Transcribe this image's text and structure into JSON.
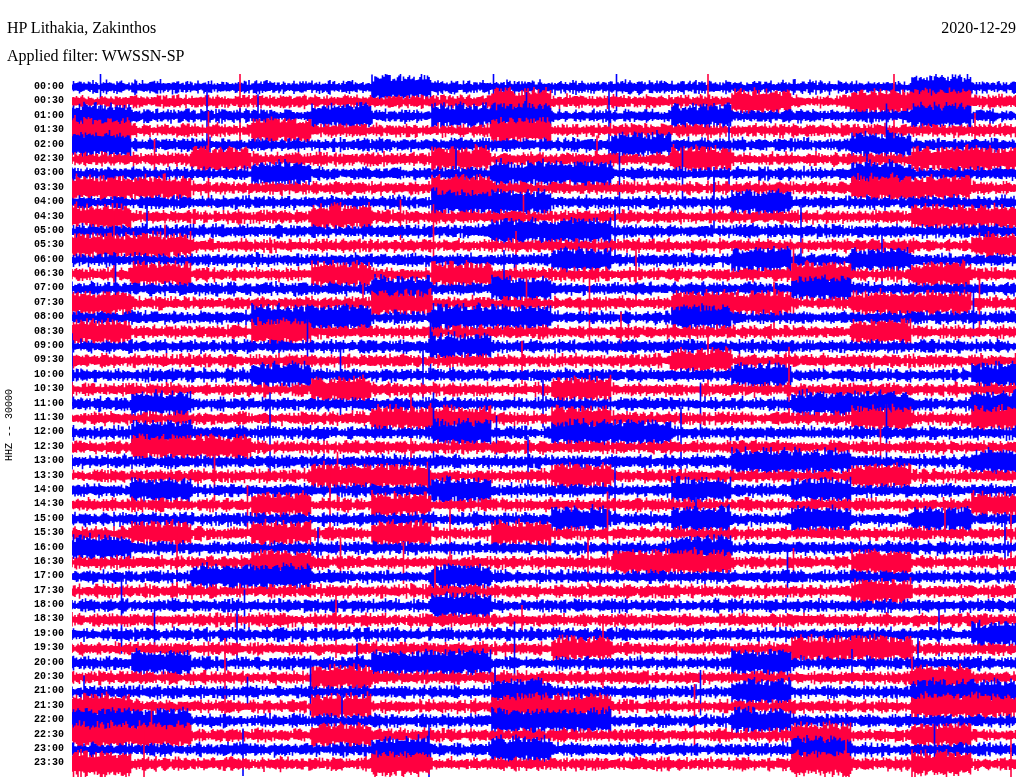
{
  "header": {
    "station": "HP Lithakia, Zakinthos",
    "date": "2020-12-29",
    "filter": "Applied filter: WWSSN-SP"
  },
  "axis_label": "HHZ -- 30000",
  "rows": [
    {
      "time": "00:00",
      "color": "#0000ff"
    },
    {
      "time": "00:30",
      "color": "#ff0040"
    },
    {
      "time": "01:00",
      "color": "#0000ff"
    },
    {
      "time": "01:30",
      "color": "#ff0040"
    },
    {
      "time": "02:00",
      "color": "#0000ff"
    },
    {
      "time": "02:30",
      "color": "#ff0040"
    },
    {
      "time": "03:00",
      "color": "#0000ff"
    },
    {
      "time": "03:30",
      "color": "#ff0040"
    },
    {
      "time": "04:00",
      "color": "#0000ff"
    },
    {
      "time": "04:30",
      "color": "#ff0040"
    },
    {
      "time": "05:00",
      "color": "#0000ff"
    },
    {
      "time": "05:30",
      "color": "#ff0040"
    },
    {
      "time": "06:00",
      "color": "#0000ff"
    },
    {
      "time": "06:30",
      "color": "#ff0040"
    },
    {
      "time": "07:00",
      "color": "#0000ff"
    },
    {
      "time": "07:30",
      "color": "#ff0040"
    },
    {
      "time": "08:00",
      "color": "#0000ff"
    },
    {
      "time": "08:30",
      "color": "#ff0040"
    },
    {
      "time": "09:00",
      "color": "#0000ff"
    },
    {
      "time": "09:30",
      "color": "#ff0040"
    },
    {
      "time": "10:00",
      "color": "#0000ff"
    },
    {
      "time": "10:30",
      "color": "#ff0040"
    },
    {
      "time": "11:00",
      "color": "#0000ff"
    },
    {
      "time": "11:30",
      "color": "#ff0040"
    },
    {
      "time": "12:00",
      "color": "#0000ff"
    },
    {
      "time": "12:30",
      "color": "#ff0040"
    },
    {
      "time": "13:00",
      "color": "#0000ff"
    },
    {
      "time": "13:30",
      "color": "#ff0040"
    },
    {
      "time": "14:00",
      "color": "#0000ff"
    },
    {
      "time": "14:30",
      "color": "#ff0040"
    },
    {
      "time": "15:00",
      "color": "#0000ff"
    },
    {
      "time": "15:30",
      "color": "#ff0040"
    },
    {
      "time": "16:00",
      "color": "#0000ff"
    },
    {
      "time": "16:30",
      "color": "#ff0040"
    },
    {
      "time": "17:00",
      "color": "#0000ff"
    },
    {
      "time": "17:30",
      "color": "#ff0040"
    },
    {
      "time": "18:00",
      "color": "#0000ff"
    },
    {
      "time": "18:30",
      "color": "#ff0040"
    },
    {
      "time": "19:00",
      "color": "#0000ff"
    },
    {
      "time": "19:30",
      "color": "#ff0040"
    },
    {
      "time": "20:00",
      "color": "#0000ff"
    },
    {
      "time": "20:30",
      "color": "#ff0040"
    },
    {
      "time": "21:00",
      "color": "#0000ff"
    },
    {
      "time": "21:30",
      "color": "#ff0040"
    },
    {
      "time": "22:00",
      "color": "#0000ff"
    },
    {
      "time": "22:30",
      "color": "#ff0040"
    },
    {
      "time": "23:00",
      "color": "#0000ff"
    },
    {
      "time": "23:30",
      "color": "#ff0040"
    }
  ]
}
